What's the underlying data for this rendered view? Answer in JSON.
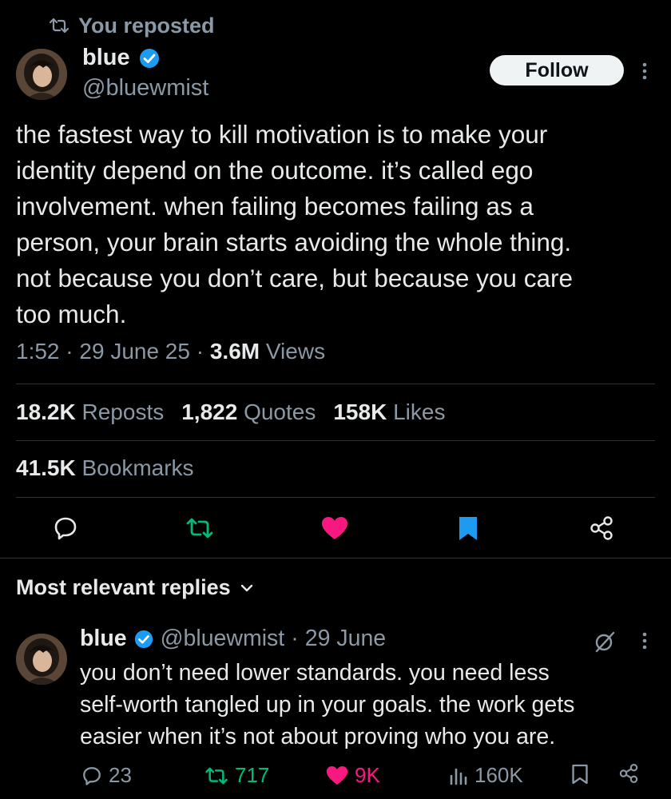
{
  "context": {
    "text": "You reposted"
  },
  "author": {
    "name": "blue",
    "handle": "@bluewmist"
  },
  "follow_label": "Follow",
  "tweet": {
    "lines": [
      "the fastest way to kill motivation is to make your",
      "identity depend on the outcome. it’s called ego",
      "involvement. when failing becomes failing as a",
      "person, your brain starts avoiding the whole thing.",
      "not because you don’t care, but because you care",
      "too much."
    ],
    "time": "1:52",
    "date": "29 June 25",
    "views_count": "3.6M",
    "views_label": "Views"
  },
  "stats": {
    "reposts_count": "18.2K",
    "reposts_label": "Reposts",
    "quotes_count": "1,822",
    "quotes_label": "Quotes",
    "likes_count": "158K",
    "likes_label": "Likes",
    "bookmarks_count": "41.5K",
    "bookmarks_label": "Bookmarks"
  },
  "colors": {
    "repost": "#00ba7c",
    "like": "#f91880",
    "bookmark": "#1d9bf0",
    "verified": "#1d9bf0",
    "muted": "#8b98a5"
  },
  "replies_header": "Most relevant replies",
  "reply": {
    "name": "blue",
    "handle": "@bluewmist",
    "date": "29 June",
    "lines": [
      "you don’t need lower standards. you need less",
      "self-worth tangled up in your goals. the work gets",
      "easier when it’s not about proving who you are."
    ],
    "replies": "23",
    "reposts": "717",
    "likes": "9K",
    "views": "160K"
  }
}
